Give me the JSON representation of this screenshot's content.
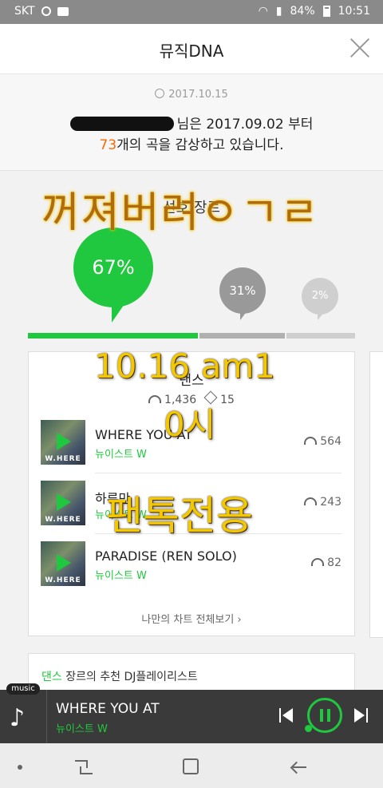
{
  "status_bar": {
    "carrier": "SKT",
    "battery": "84%",
    "time": "10:51"
  },
  "header": {
    "title": "뮤직DNA"
  },
  "summary": {
    "date": "2017.10.15",
    "line1_suffix": "님은 2017.09.02 부터",
    "song_count": "73",
    "line2_suffix": "개의 곡을 감상하고 있습니다."
  },
  "genre": {
    "section_title": "선호 장르",
    "percents": [
      "67%",
      "31%",
      "2%"
    ],
    "bar_shares": [
      0.67,
      0.31,
      0.02
    ],
    "card": {
      "genre_name": "댄스",
      "listens": "1,436",
      "likes": "15",
      "tracks": [
        {
          "title": "WHERE YOU AT",
          "artist": "뉴이스트 W",
          "plays": "564",
          "cover_text": "W.HERE"
        },
        {
          "title": "하루만",
          "artist": "뉴이스트 W",
          "plays": "243",
          "cover_text": "W.HERE"
        },
        {
          "title": "PARADISE (REN SOLO)",
          "artist": "뉴이스트 W",
          "plays": "82",
          "cover_text": "W.HERE"
        }
      ],
      "more_link": "나만의 차트 전체보기 ›"
    },
    "recommend": {
      "genre": "댄스",
      "text": " 장르의 추천 DJ플레이리스트"
    }
  },
  "overlays": {
    "line1": "꺼져버려ㅇㄱㄹ",
    "line2": "10.16 am1",
    "line3": "0시",
    "line4": "팬톡전용"
  },
  "player": {
    "tag": "music",
    "title": "WHERE YOU AT",
    "artist": "뉴이스트 W"
  },
  "colors": {
    "accent_green": "#1fc83e",
    "orange": "#ff6a00",
    "overlay_yellow": "#f2c800"
  }
}
